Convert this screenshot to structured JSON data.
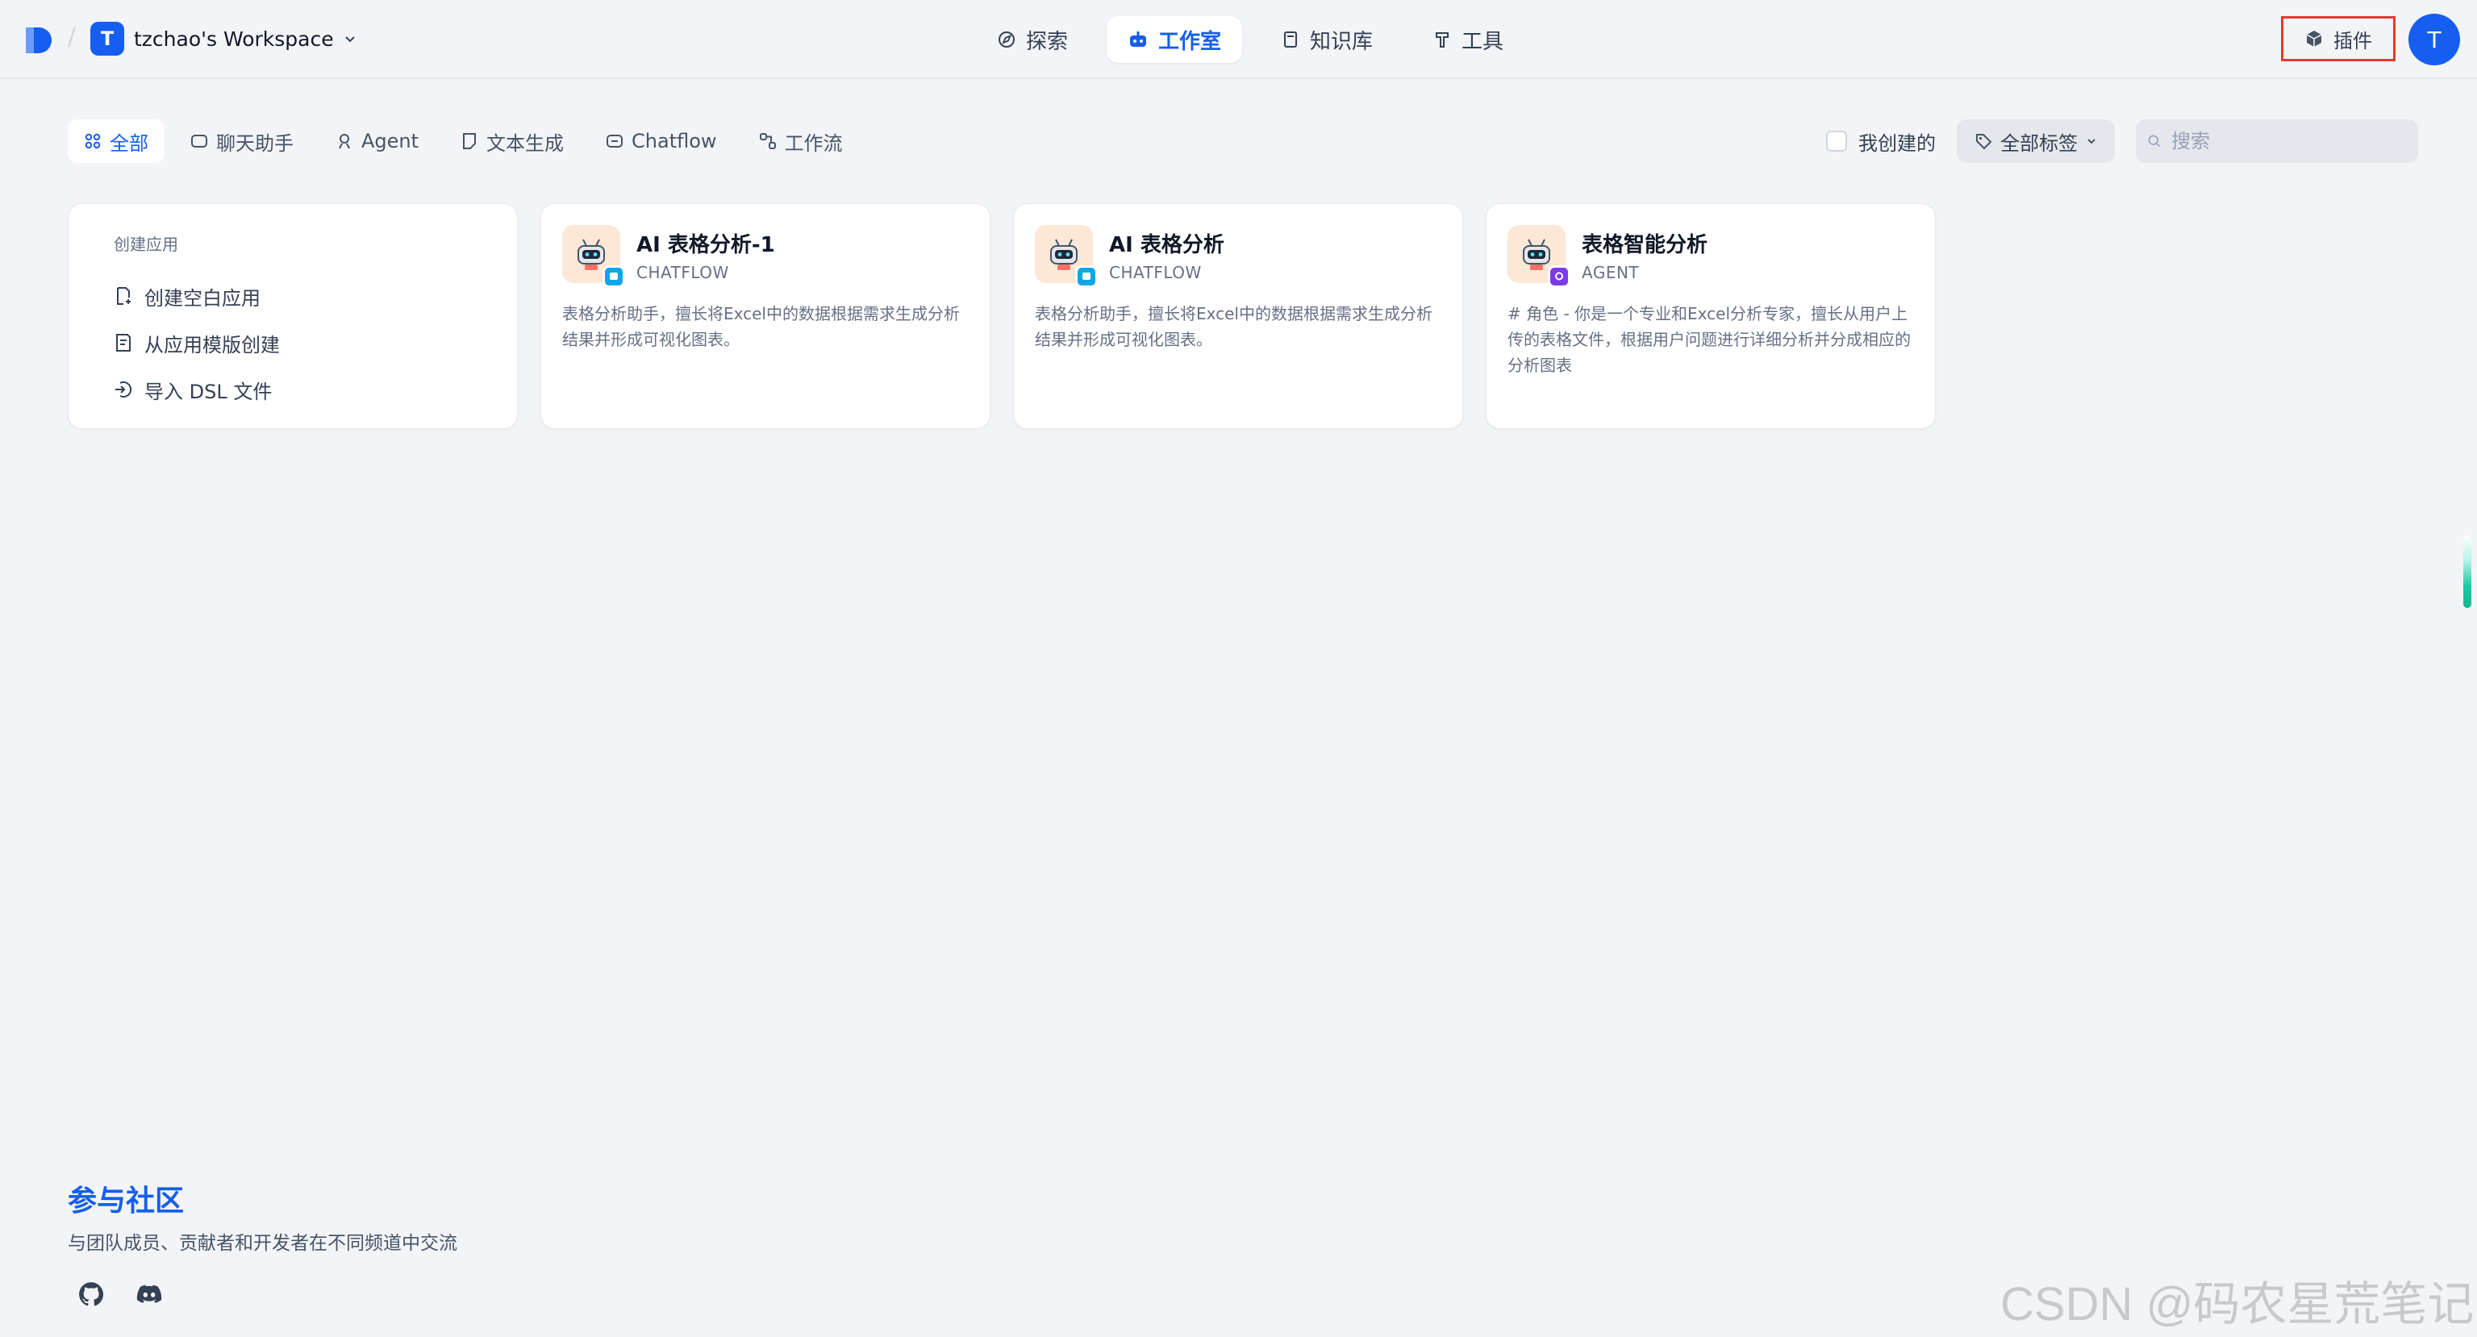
{
  "header": {
    "workspace_initial": "T",
    "workspace_name": "tzchao's Workspace",
    "nav": [
      {
        "label": "探索",
        "icon": "compass-icon"
      },
      {
        "label": "工作室",
        "icon": "robot-icon",
        "active": true
      },
      {
        "label": "知识库",
        "icon": "book-icon"
      },
      {
        "label": "工具",
        "icon": "hammer-icon"
      }
    ],
    "plugin_label": "插件",
    "user_initial": "T"
  },
  "filters": {
    "tabs": [
      {
        "label": "全部",
        "icon": "grid-icon",
        "active": true
      },
      {
        "label": "聊天助手",
        "icon": "chat-icon"
      },
      {
        "label": "Agent",
        "icon": "agent-icon"
      },
      {
        "label": "文本生成",
        "icon": "document-icon"
      },
      {
        "label": "Chatflow",
        "icon": "chatflow-icon"
      },
      {
        "label": "工作流",
        "icon": "workflow-icon"
      }
    ],
    "mine_label": "我创建的",
    "tags_label": "全部标签",
    "search_placeholder": "搜索"
  },
  "create": {
    "heading": "创建应用",
    "items": [
      {
        "label": "创建空白应用",
        "icon": "file-plus-icon"
      },
      {
        "label": "从应用模版创建",
        "icon": "template-icon"
      },
      {
        "label": "导入 DSL 文件",
        "icon": "import-icon"
      }
    ]
  },
  "apps": [
    {
      "name": "AI 表格分析-1",
      "mode": "CHATFLOW",
      "badge_color": "#0ea5e9",
      "description": "表格分析助手，擅长将Excel中的数据根据需求生成分析结果并形成可视化图表。"
    },
    {
      "name": "AI 表格分析",
      "mode": "CHATFLOW",
      "badge_color": "#0ea5e9",
      "description": "表格分析助手，擅长将Excel中的数据根据需求生成分析结果并形成可视化图表。"
    },
    {
      "name": "表格智能分析",
      "mode": "AGENT",
      "badge_color": "#7c3aed",
      "description": "# 角色 - 你是一个专业和Excel分析专家，擅长从用户上传的表格文件，根据用户问题进行详细分析并分成相应的分析图表"
    }
  ],
  "community": {
    "title": "参与社区",
    "subtitle": "与团队成员、贡献者和开发者在不同频道中交流"
  },
  "watermark": "CSDN @码农星荒笔记",
  "colors": {
    "accent": "#155eef",
    "background": "#f2f4f7",
    "highlight_border": "#e53935"
  }
}
